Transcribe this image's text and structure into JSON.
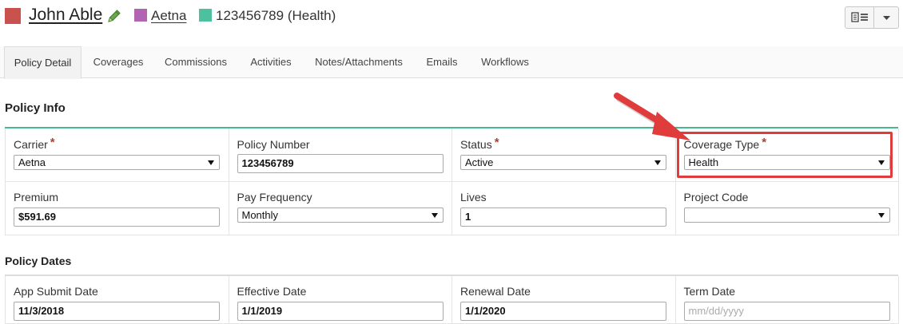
{
  "header": {
    "client_name": "John Able",
    "carrier_link": "Aetna",
    "policy_label": "123456789 (Health)",
    "colors": {
      "client": "#c9524f",
      "carrier": "#b065b3",
      "policy": "#4dc0a0"
    }
  },
  "tabs": [
    {
      "label": "Policy Detail",
      "active": true
    },
    {
      "label": "Coverages"
    },
    {
      "label": "Commissions"
    },
    {
      "label": "Activities"
    },
    {
      "label": "Notes/Attachments"
    },
    {
      "label": "Emails"
    },
    {
      "label": "Workflows"
    }
  ],
  "policy_info": {
    "title": "Policy Info",
    "carrier": {
      "label": "Carrier",
      "required_mark": "*",
      "value": "Aetna"
    },
    "policy_number": {
      "label": "Policy Number",
      "value": "123456789"
    },
    "status": {
      "label": "Status",
      "required_mark": "*",
      "value": "Active"
    },
    "coverage_type": {
      "label": "Coverage Type",
      "required_mark": "*",
      "value": "Health"
    },
    "premium": {
      "label": "Premium",
      "value": "$591.69"
    },
    "pay_frequency": {
      "label": "Pay Frequency",
      "value": "Monthly"
    },
    "lives": {
      "label": "Lives",
      "value": "1"
    },
    "project_code": {
      "label": "Project Code",
      "value": ""
    }
  },
  "policy_dates": {
    "title": "Policy Dates",
    "app_submit_date": {
      "label": "App Submit Date",
      "value": "11/3/2018"
    },
    "effective_date": {
      "label": "Effective Date",
      "value": "1/1/2019"
    },
    "renewal_date": {
      "label": "Renewal Date",
      "value": "1/1/2020"
    },
    "term_date": {
      "label": "Term Date",
      "placeholder": "mm/dd/yyyy"
    }
  },
  "annotation": {
    "color": "#e03c3c"
  }
}
